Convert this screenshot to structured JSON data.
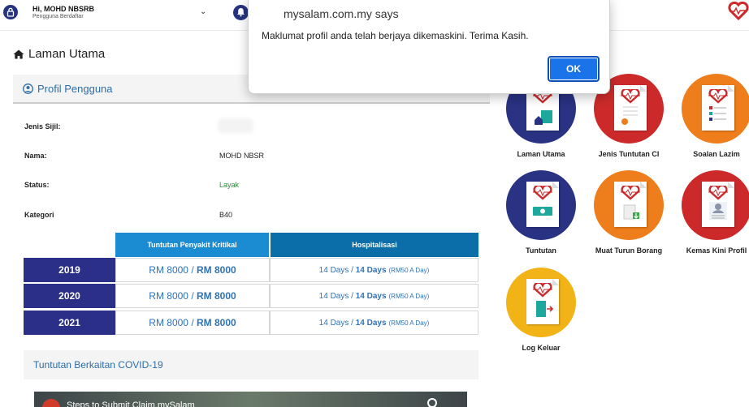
{
  "header": {
    "greeting": "Hi, MOHD NBSRB",
    "subtitle": "Pengguna Berdaftar",
    "chevron": "⌄"
  },
  "breadcrumb": {
    "label": "Laman Utama"
  },
  "profile": {
    "title": "Profil Pengguna",
    "rows": [
      {
        "label": "Jenis Sijil:",
        "value": ""
      },
      {
        "label": "Nama:",
        "value": "MOHD NBSR"
      },
      {
        "label": "Status:",
        "value": "Layak"
      },
      {
        "label": "Kategori",
        "value": "B40"
      }
    ]
  },
  "claims": {
    "headers": [
      "Tuntutan Penyakit Kritikal",
      "Hospitalisasi"
    ],
    "rows": [
      {
        "year": "2019",
        "ci_a": "RM 8000",
        "ci_b": "RM 8000",
        "h_a": "14 Days",
        "h_b": "14 Days",
        "h_note": "(RM50 A Day)"
      },
      {
        "year": "2020",
        "ci_a": "RM 8000",
        "ci_b": "RM 8000",
        "h_a": "14 Days",
        "h_b": "14 Days",
        "h_note": "(RM50 A Day)"
      },
      {
        "year": "2021",
        "ci_a": "RM 8000",
        "ci_b": "RM 8000",
        "h_a": "14 Days",
        "h_b": "14 Days",
        "h_note": "(RM50 A Day)"
      }
    ],
    "sep": "/"
  },
  "covid": {
    "title": "Tuntutan Berkaitan COVID-19",
    "video_title": "Steps to Submit Claim mySalam"
  },
  "menu": {
    "items": [
      {
        "label": "Laman Utama",
        "color": "#2a3283"
      },
      {
        "label": "Jenis Tuntutan CI",
        "color": "#cc2a2a"
      },
      {
        "label": "Soalan Lazim",
        "color": "#ee7d1b"
      },
      {
        "label": "Tuntutan",
        "color": "#2a3283"
      },
      {
        "label": "Muat Turun Borang",
        "color": "#ee7d1b"
      },
      {
        "label": "Kemas Kini Profil",
        "color": "#cc2a2a"
      },
      {
        "label": "Log Keluar",
        "color": "#f2b317"
      }
    ]
  },
  "dialog": {
    "title": "mysalam.com.my says",
    "message": "Maklumat profil anda telah berjaya dikemaskini. Terima Kasih.",
    "ok_label": "OK"
  },
  "colors": {
    "navy": "#2b2f87",
    "blue_header": "#1b8bd2",
    "link_blue": "#2f73b5",
    "status_green": "#2e8b3a",
    "dialog_button": "#1a73e8"
  }
}
